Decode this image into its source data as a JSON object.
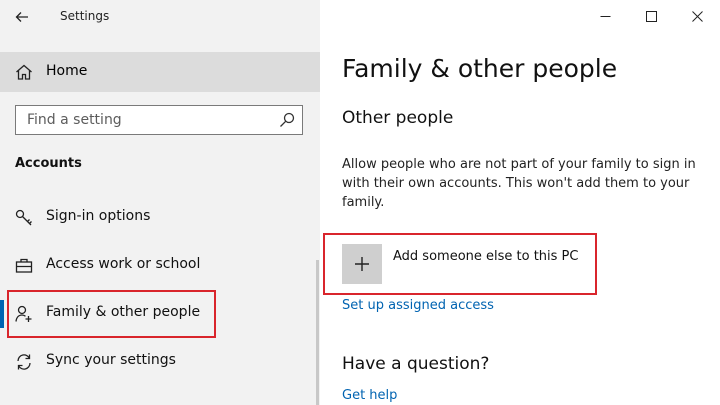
{
  "window": {
    "title": "Settings",
    "controls": [
      "minimize",
      "maximize",
      "close"
    ]
  },
  "sidebar": {
    "home_label": "Home",
    "search_placeholder": "Find a setting",
    "section_header": "Accounts",
    "items": [
      {
        "label": "Sign-in options",
        "icon": "key-icon",
        "active": false
      },
      {
        "label": "Access work or school",
        "icon": "briefcase-icon",
        "active": false
      },
      {
        "label": "Family & other people",
        "icon": "person-add-icon",
        "active": true
      },
      {
        "label": "Sync your settings",
        "icon": "sync-icon",
        "active": false
      }
    ]
  },
  "main": {
    "title": "Family & other people",
    "subtitle": "Other people",
    "description": "Allow people who are not part of your family to sign in with their own accounts. This won't add them to your family.",
    "add_button_label": "Add someone else to this PC",
    "assigned_access_link": "Set up assigned access",
    "question_heading": "Have a question?",
    "help_link": "Get help"
  },
  "colors": {
    "accent": "#0063b1",
    "highlight_frame": "#d9252c"
  }
}
